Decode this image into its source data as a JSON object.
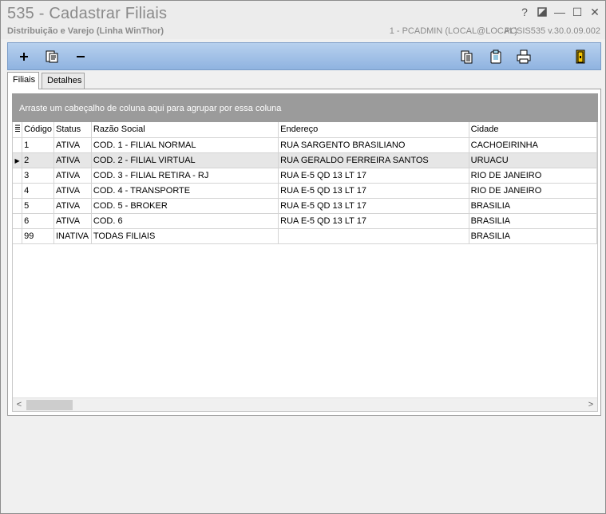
{
  "window": {
    "title": "535 - Cadastrar Filiais",
    "subtitle": "Distribuição e Varejo (Linha WinThor)",
    "user_info": "1 - PCADMIN (LOCAL@LOCAL)",
    "app_code": "PCSIS535  v.30.0.09.002",
    "help_label": "?",
    "minimize_label": "—",
    "maximize_label": "☐",
    "close_label": "✕"
  },
  "toolbar": {
    "buttons": [
      "add-icon",
      "edit-icon",
      "remove-icon",
      "copy-icon",
      "clipboard-icon",
      "print-icon",
      "exit-icon"
    ]
  },
  "tabs": [
    {
      "label": "Filiais",
      "active": true
    },
    {
      "label": "Detalhes",
      "active": false
    }
  ],
  "group_panel_text": "Arraste um cabeçalho de coluna aqui para agrupar por essa coluna",
  "grid": {
    "columns": [
      "Código",
      "Status",
      "Razão Social",
      "Endereço",
      "Cidade"
    ],
    "rows": [
      [
        "1",
        "ATIVA",
        "COD. 1 - FILIAL NORMAL",
        "RUA SARGENTO BRASILIANO",
        "CACHOEIRINHA"
      ],
      [
        "2",
        "ATIVA",
        "COD. 2 - FILIAL VIRTUAL",
        "RUA GERALDO FERREIRA SANTOS",
        "URUACU"
      ],
      [
        "3",
        "ATIVA",
        "COD. 3 - FILIAL RETIRA - RJ",
        "RUA E-5 QD 13 LT 17",
        "RIO DE JANEIRO"
      ],
      [
        "4",
        "ATIVA",
        "COD. 4 - TRANSPORTE",
        "RUA E-5 QD 13 LT 17",
        "RIO DE JANEIRO"
      ],
      [
        "5",
        "ATIVA",
        "COD. 5 - BROKER",
        "RUA E-5 QD 13 LT 17",
        "BRASILIA"
      ],
      [
        "6",
        "ATIVA",
        "COD. 6",
        "RUA E-5 QD 13 LT 17",
        "BRASILIA"
      ],
      [
        "99",
        "INATIVA",
        "TODAS FILIAIS",
        "",
        "BRASILIA"
      ]
    ],
    "selected_row": 1
  }
}
